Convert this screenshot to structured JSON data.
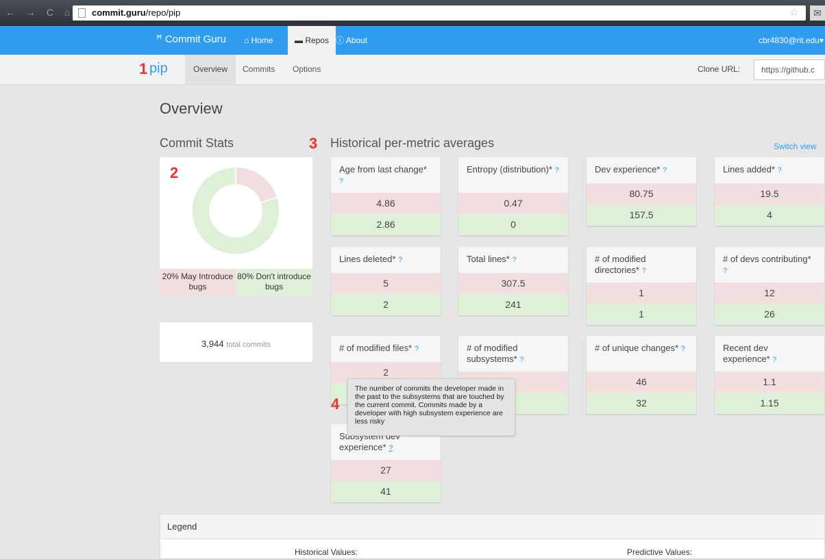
{
  "browser": {
    "url_host": "commit.guru",
    "url_path": "/repo/pip",
    "nav_glyphs": "← → C ⌂"
  },
  "navbar": {
    "brand": "Commit Guru",
    "items": [
      {
        "label": "Home",
        "icon": "home-icon"
      },
      {
        "label": "Repos",
        "icon": "archive-icon"
      },
      {
        "label": "About",
        "icon": "info-icon"
      }
    ],
    "user": "cbr4830@rit.edu"
  },
  "subnav": {
    "repo": "pip",
    "tabs": [
      "Overview",
      "Commits",
      "Options"
    ],
    "clone_label": "Clone URL:",
    "clone_value": "https://github.c"
  },
  "markers": [
    "1",
    "2",
    "3",
    "4"
  ],
  "main": {
    "title": "Overview",
    "commit_stats_title": "Commit Stats",
    "historical_title": "Historical per-metric averages",
    "switch_view": "Switch view",
    "donut": {
      "may_introduce_pct": 20,
      "dont_introduce_pct": 80,
      "may_label": "20% May Introduce bugs",
      "dont_label": "80% Don't introduce bugs",
      "colors": {
        "buggy": "#f2dede",
        "clean": "#dff0d8"
      }
    },
    "total_commits": "3,944",
    "total_label": "total commits"
  },
  "metrics": [
    {
      "label": "Age from last change*",
      "buggy": "4.86",
      "clean": "2.86"
    },
    {
      "label": "Entropy (distribution)*",
      "buggy": "0.47",
      "clean": "0"
    },
    {
      "label": "Dev experience*",
      "buggy": "80.75",
      "clean": "157.5"
    },
    {
      "label": "Lines added*",
      "buggy": "19.5",
      "clean": "4"
    },
    {
      "label": "Lines deleted*",
      "buggy": "5",
      "clean": "2"
    },
    {
      "label": "Total lines*",
      "buggy": "307.5",
      "clean": "241"
    },
    {
      "label": "# of modified directories*",
      "buggy": "1",
      "clean": "1"
    },
    {
      "label": "# of devs contributing*",
      "buggy": "12",
      "clean": "26"
    },
    {
      "label": "# of modified files*",
      "buggy": "2",
      "clean": ""
    },
    {
      "label": "# of modified subsystems*",
      "buggy": "",
      "clean": ""
    },
    {
      "label": "# of unique changes*",
      "buggy": "46",
      "clean": "32"
    },
    {
      "label": "Recent dev experience*",
      "buggy": "1.1",
      "clean": "1.15"
    },
    {
      "label": "Subsystem dev experience*",
      "buggy": "27",
      "clean": "41"
    }
  ],
  "help_mark": "?",
  "tooltip": "The number of commits the developer made in the past to the subsystems that are touched by the current commit. Commits made by a developer with high subsystem experience are less risky",
  "legend": {
    "title": "Legend",
    "historical": "Historical Values:",
    "predictive": "Predictive Values:"
  }
}
